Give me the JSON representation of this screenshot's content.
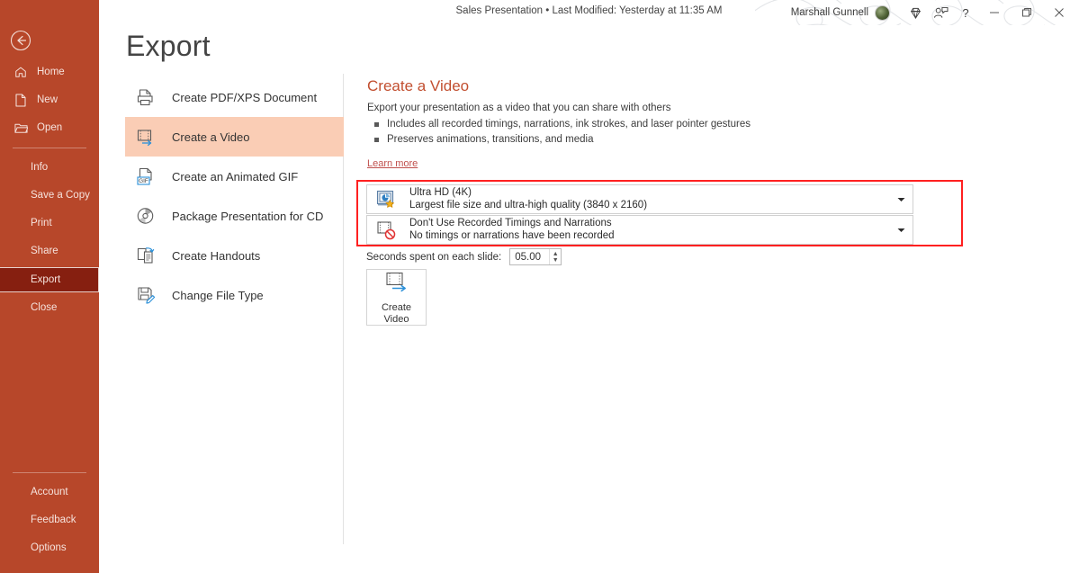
{
  "window": {
    "doc_title": "Sales Presentation • Last Modified: Yesterday at 11:35 AM",
    "user_name": "Marshall Gunnell",
    "minimize_label": "–",
    "maximize_label": "❐",
    "close_label": "✕",
    "help_label": "?"
  },
  "sidebar": {
    "back_label": "Back",
    "top_items": [
      {
        "label": "Home",
        "icon": "home-icon"
      },
      {
        "label": "New",
        "icon": "new-document-icon"
      },
      {
        "label": "Open",
        "icon": "open-folder-icon"
      }
    ],
    "mid_items": [
      {
        "label": "Info",
        "selected": false
      },
      {
        "label": "Save a Copy",
        "selected": false
      },
      {
        "label": "Print",
        "selected": false
      },
      {
        "label": "Share",
        "selected": false
      },
      {
        "label": "Export",
        "selected": true
      },
      {
        "label": "Close",
        "selected": false
      }
    ],
    "bottom_items": [
      {
        "label": "Account"
      },
      {
        "label": "Feedback"
      },
      {
        "label": "Options"
      }
    ],
    "background_color": "#B7472A",
    "selected_color": "#861F10"
  },
  "page": {
    "title": "Export"
  },
  "export_options": [
    {
      "label": "Create PDF/XPS Document",
      "icon": "pdf-xps-icon",
      "active": false
    },
    {
      "label": "Create a Video",
      "icon": "video-film-icon",
      "active": true
    },
    {
      "label": "Create an Animated GIF",
      "icon": "gif-icon",
      "active": false
    },
    {
      "label": "Package Presentation for CD",
      "icon": "cd-disc-icon",
      "active": false
    },
    {
      "label": "Create Handouts",
      "icon": "handouts-icon",
      "active": false
    },
    {
      "label": "Change File Type",
      "icon": "change-file-type-icon",
      "active": false
    }
  ],
  "detail": {
    "heading": "Create a Video",
    "subtitle": "Export your presentation as a video that you can share with others",
    "bullets": [
      "Includes all recorded timings, narrations, ink strokes, and laser pointer gestures",
      "Preserves animations, transitions, and media"
    ],
    "learn_more": "Learn more",
    "heading_color": "#C24F30"
  },
  "dropdowns": [
    {
      "primary": "Ultra HD (4K)",
      "secondary": "Largest file size and ultra-high quality (3840 x 2160)",
      "icon": "monitor-quality-icon",
      "caret": "▼"
    },
    {
      "primary": "Don't Use Recorded Timings and Narrations",
      "secondary": "No timings or narrations have been recorded",
      "icon": "no-timings-icon",
      "caret": "▼"
    }
  ],
  "seconds": {
    "label": "Seconds spent on each slide:",
    "value": "05.00",
    "up_arrow": "▲",
    "down_arrow": "▼"
  },
  "create_video_button": {
    "line1": "Create",
    "line2": "Video",
    "icon": "create-video-icon"
  },
  "annotation": {
    "color": "#FF2020",
    "shape": "rectangle"
  }
}
